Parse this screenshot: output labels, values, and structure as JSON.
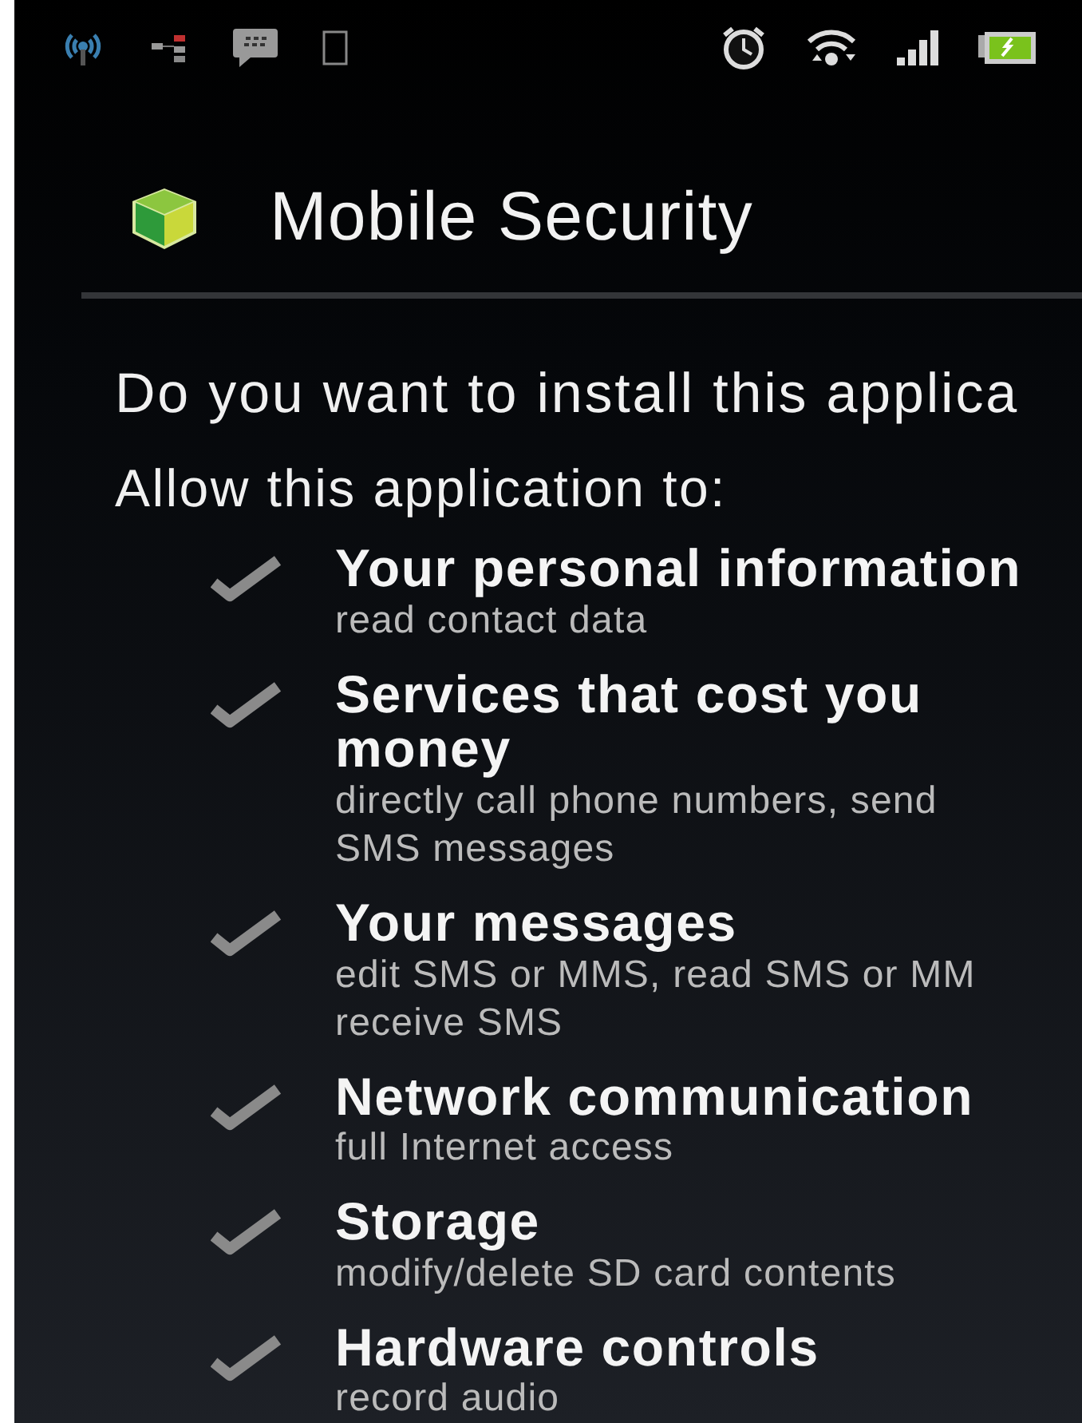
{
  "app": {
    "title": "Mobile Security"
  },
  "question": "Do you want to install this applica",
  "permissions_heading": "Allow this application to:",
  "permissions": [
    {
      "title": "Your personal information",
      "description": "read contact data"
    },
    {
      "title": "Services that cost you money",
      "description": "directly call phone numbers, send\nSMS messages"
    },
    {
      "title": "Your messages",
      "description": "edit SMS or MMS, read SMS or MM\nreceive SMS"
    },
    {
      "title": "Network communication",
      "description": "full Internet access"
    },
    {
      "title": "Storage",
      "description": "modify/delete SD card contents"
    },
    {
      "title": "Hardware controls",
      "description": "record audio"
    }
  ]
}
